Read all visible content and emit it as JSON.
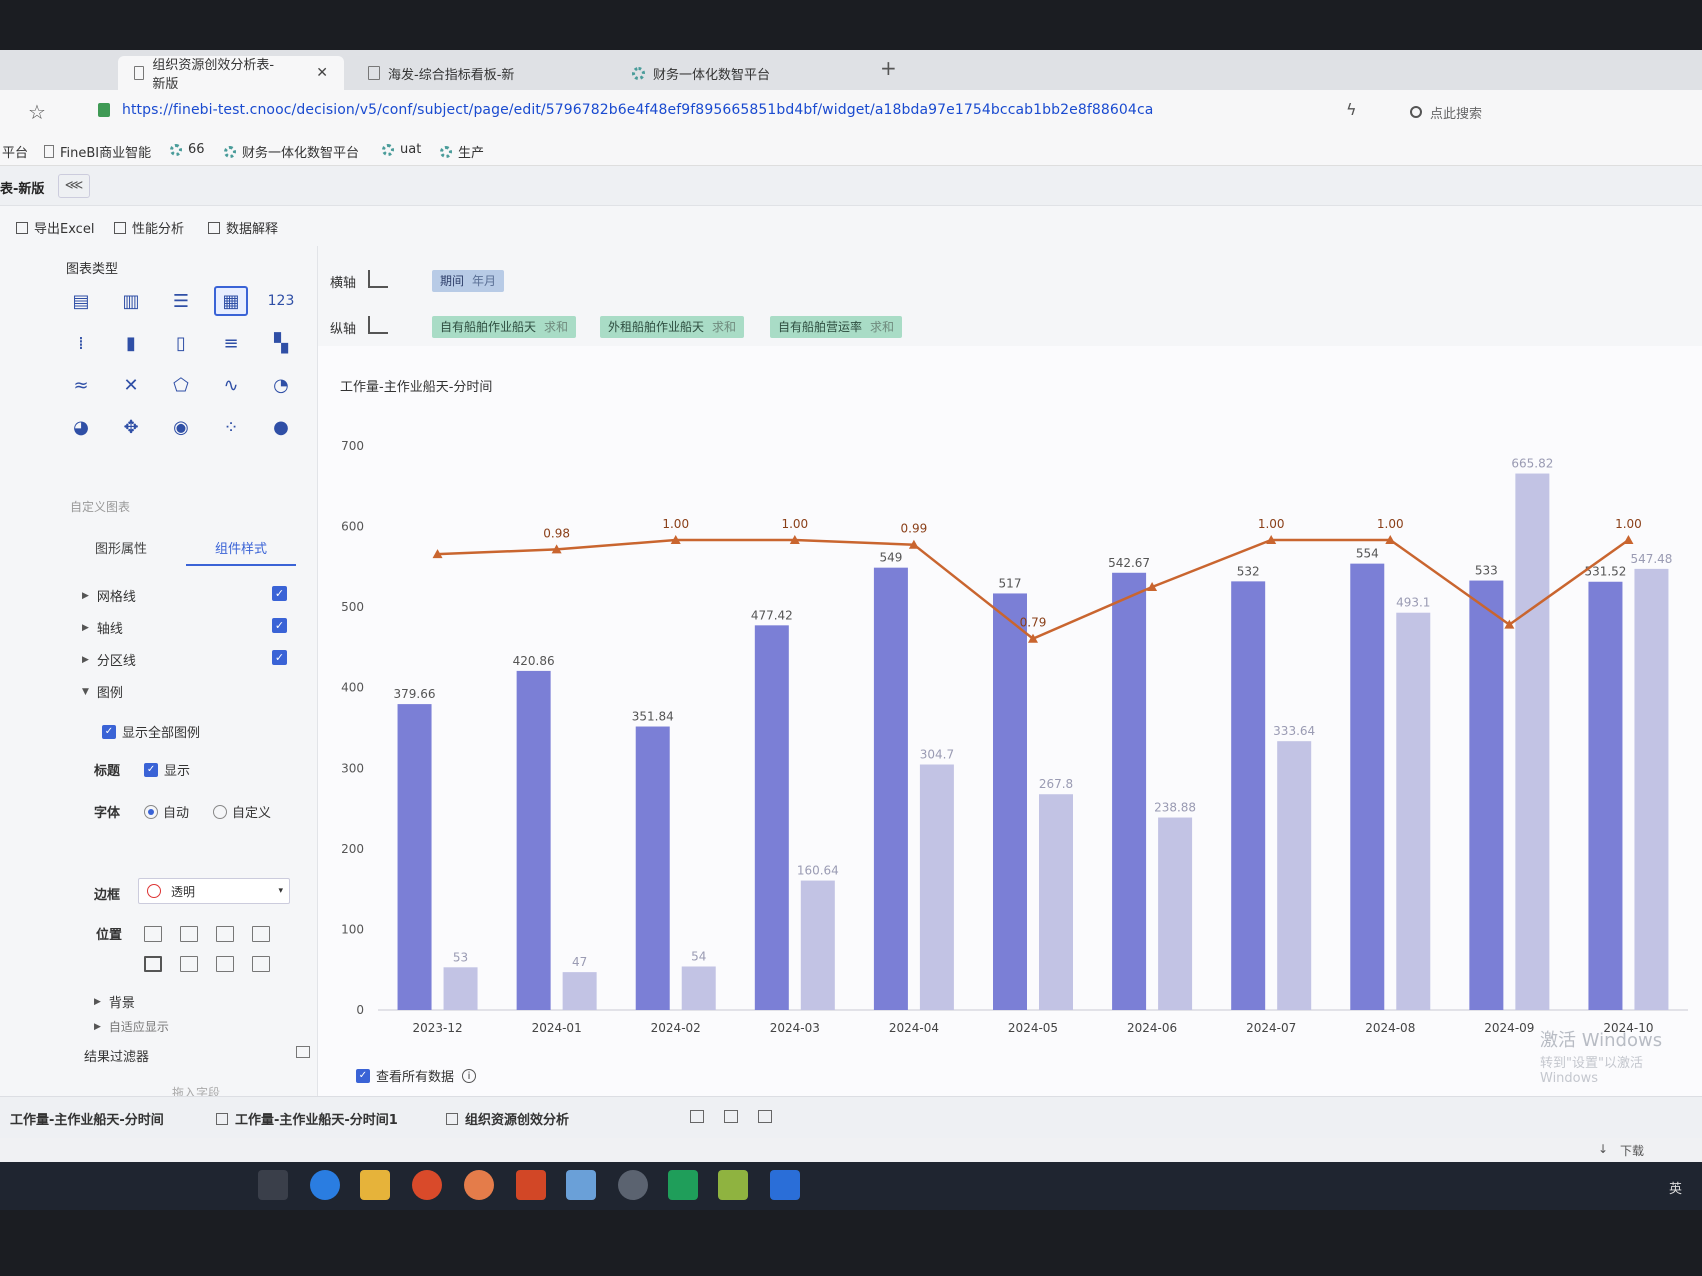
{
  "browser": {
    "tabs": [
      {
        "label": "组织资源创效分析表-新版",
        "active": true
      },
      {
        "label": "海发-综合指标看板-新",
        "active": false
      },
      {
        "label": "财务一体化数智平台",
        "active": false
      }
    ],
    "url": "https://finebi-test.cnooc/decision/v5/conf/subject/page/edit/5796782b6e4f48ef9f895665851bd4bf/widget/a18bda97e1754bccab1bb2e8f88604ca",
    "search_placeholder": "点此搜索",
    "bookmarks": [
      "平台",
      "FineBI商业智能",
      "66",
      "财务一体化数智平台",
      "uat",
      "生产"
    ]
  },
  "app": {
    "title": "表-新版",
    "toolbar": [
      "导出Excel",
      "性能分析",
      "数据解释"
    ]
  },
  "left_panel": {
    "chart_type_title": "图表类型",
    "custom_chart": "自定义图表",
    "tabs": [
      "图形属性",
      "组件样式"
    ],
    "props": {
      "gridline": "网格线",
      "axis": "轴线",
      "zone": "分区线",
      "legend": "图例",
      "show_all_legend": "显示全部图例",
      "title_label": "标题",
      "title_show": "显示",
      "font_label": "字体",
      "font_auto": "自动",
      "font_custom": "自定义",
      "border_label": "边框",
      "border_value": "透明",
      "position_label": "位置",
      "background": "背景",
      "adaptive": "自适应显示"
    },
    "filter_title": "结果过滤器",
    "drag_field": "拖入字段"
  },
  "axis_config": {
    "x_label": "横轴",
    "y_label": "纵轴",
    "x_field": {
      "name": "期间",
      "agg": "年月"
    },
    "y_fields": [
      {
        "name": "自有船舶作业船天",
        "agg": "求和"
      },
      {
        "name": "外租船舶作业船天",
        "agg": "求和"
      },
      {
        "name": "自有船舶营运率",
        "agg": "求和"
      }
    ]
  },
  "chart_data": {
    "type": "bar",
    "title": "工作量-主作业船天-分时间",
    "categories": [
      "2023-12",
      "2024-01",
      "2024-02",
      "2024-03",
      "2024-04",
      "2024-05",
      "2024-06",
      "2024-07",
      "2024-08",
      "2024-09",
      "2024-10"
    ],
    "ylim": [
      0,
      700
    ],
    "yticks": [
      "0",
      "100",
      "200",
      "300",
      "400",
      "500",
      "600",
      "700"
    ],
    "series": [
      {
        "values": [
          379.66,
          420.86,
          351.84,
          477.42,
          549,
          517,
          542.67,
          532,
          554,
          533,
          531.52
        ],
        "color": "#7b7fd6"
      },
      {
        "values": [
          53,
          47,
          54,
          160.64,
          304.7,
          267.8,
          238.88,
          333.64,
          493.1,
          665.82,
          547.48
        ],
        "color": "#c2c3e4"
      }
    ],
    "line": {
      "values": [
        0.97,
        0.98,
        1.0,
        1.0,
        0.99,
        0.79,
        0.9,
        1.0,
        1.0,
        0.82,
        1.0
      ],
      "labels": [
        "",
        "0.98",
        "1.00",
        "1.00",
        "0.99",
        "0.79",
        "",
        "1.00",
        "1.00",
        "",
        "1.00"
      ],
      "color": "#c9652f"
    },
    "grid": false
  },
  "chart_footer": {
    "view_all": "查看所有数据"
  },
  "watermark": {
    "line1": "激活 Windows",
    "line2": "转到\"设置\"以激活 Windows"
  },
  "sheets": [
    "工作量-主作业船天-分时间",
    "工作量-主作业船天-分时间1",
    "组织资源创效分析"
  ],
  "status": {
    "download": "下载"
  },
  "tray": {
    "lang": "英"
  }
}
